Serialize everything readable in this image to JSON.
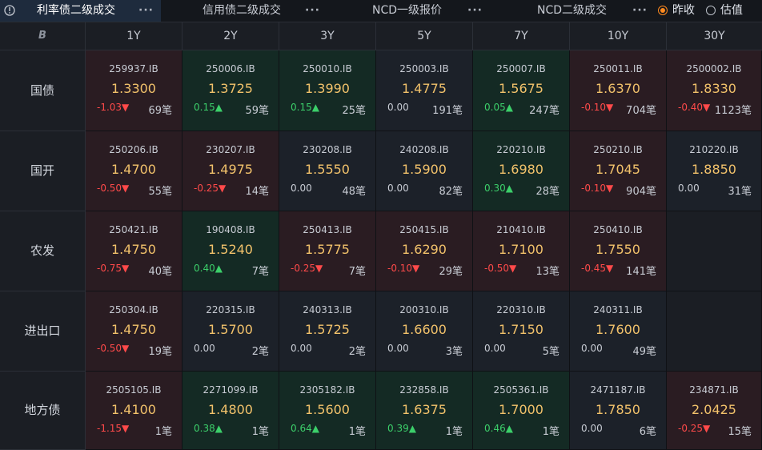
{
  "tabs": [
    {
      "label": "利率债二级成交",
      "active": true
    },
    {
      "label": "信用债二级成交",
      "active": false
    },
    {
      "label": "NCD一级报价",
      "active": false
    },
    {
      "label": "NCD二级成交",
      "active": false
    }
  ],
  "tab_menu_glyph": "···",
  "radios": [
    {
      "label": "昨收",
      "checked": true
    },
    {
      "label": "估值",
      "checked": false
    }
  ],
  "corner_logo": "B",
  "columns": [
    "1Y",
    "2Y",
    "3Y",
    "5Y",
    "7Y",
    "10Y",
    "30Y"
  ],
  "rows": [
    {
      "label": "国债",
      "cells": [
        {
          "code": "259937.IB",
          "yield": "1.3300",
          "change": "-1.03▼",
          "dir": "down",
          "count": "69笔",
          "bg": "red"
        },
        {
          "code": "250006.IB",
          "yield": "1.3725",
          "change": "0.15▲",
          "dir": "up",
          "count": "59笔",
          "bg": "green"
        },
        {
          "code": "250010.IB",
          "yield": "1.3990",
          "change": "0.15▲",
          "dir": "up",
          "count": "25笔",
          "bg": "green"
        },
        {
          "code": "250003.IB",
          "yield": "1.4775",
          "change": "0.00",
          "dir": "flat",
          "count": "191笔",
          "bg": "neutral"
        },
        {
          "code": "250007.IB",
          "yield": "1.5675",
          "change": "0.05▲",
          "dir": "up",
          "count": "247笔",
          "bg": "green"
        },
        {
          "code": "250011.IB",
          "yield": "1.6370",
          "change": "-0.10▼",
          "dir": "down",
          "count": "704笔",
          "bg": "red"
        },
        {
          "code": "2500002.IB",
          "yield": "1.8330",
          "change": "-0.40▼",
          "dir": "down",
          "count": "1123笔",
          "bg": "red"
        }
      ]
    },
    {
      "label": "国开",
      "cells": [
        {
          "code": "250206.IB",
          "yield": "1.4700",
          "change": "-0.50▼",
          "dir": "down",
          "count": "55笔",
          "bg": "red"
        },
        {
          "code": "230207.IB",
          "yield": "1.4975",
          "change": "-0.25▼",
          "dir": "down",
          "count": "14笔",
          "bg": "red"
        },
        {
          "code": "230208.IB",
          "yield": "1.5550",
          "change": "0.00",
          "dir": "flat",
          "count": "48笔",
          "bg": "neutral"
        },
        {
          "code": "240208.IB",
          "yield": "1.5900",
          "change": "0.00",
          "dir": "flat",
          "count": "82笔",
          "bg": "neutral"
        },
        {
          "code": "220210.IB",
          "yield": "1.6980",
          "change": "0.30▲",
          "dir": "up",
          "count": "28笔",
          "bg": "green"
        },
        {
          "code": "250210.IB",
          "yield": "1.7045",
          "change": "-0.10▼",
          "dir": "down",
          "count": "904笔",
          "bg": "red"
        },
        {
          "code": "210220.IB",
          "yield": "1.8850",
          "change": "0.00",
          "dir": "flat",
          "count": "31笔",
          "bg": "neutral"
        }
      ]
    },
    {
      "label": "农发",
      "cells": [
        {
          "code": "250421.IB",
          "yield": "1.4750",
          "change": "-0.75▼",
          "dir": "down",
          "count": "40笔",
          "bg": "red"
        },
        {
          "code": "190408.IB",
          "yield": "1.5240",
          "change": "0.40▲",
          "dir": "up",
          "count": "7笔",
          "bg": "green"
        },
        {
          "code": "250413.IB",
          "yield": "1.5775",
          "change": "-0.25▼",
          "dir": "down",
          "count": "7笔",
          "bg": "red"
        },
        {
          "code": "250415.IB",
          "yield": "1.6290",
          "change": "-0.10▼",
          "dir": "down",
          "count": "29笔",
          "bg": "red"
        },
        {
          "code": "210410.IB",
          "yield": "1.7100",
          "change": "-0.50▼",
          "dir": "down",
          "count": "13笔",
          "bg": "red"
        },
        {
          "code": "250410.IB",
          "yield": "1.7550",
          "change": "-0.45▼",
          "dir": "down",
          "count": "141笔",
          "bg": "red"
        },
        null
      ]
    },
    {
      "label": "进出口",
      "cells": [
        {
          "code": "250304.IB",
          "yield": "1.4750",
          "change": "-0.50▼",
          "dir": "down",
          "count": "19笔",
          "bg": "red"
        },
        {
          "code": "220315.IB",
          "yield": "1.5700",
          "change": "0.00",
          "dir": "flat",
          "count": "2笔",
          "bg": "neutral"
        },
        {
          "code": "240313.IB",
          "yield": "1.5725",
          "change": "0.00",
          "dir": "flat",
          "count": "2笔",
          "bg": "neutral"
        },
        {
          "code": "200310.IB",
          "yield": "1.6600",
          "change": "0.00",
          "dir": "flat",
          "count": "3笔",
          "bg": "neutral"
        },
        {
          "code": "220310.IB",
          "yield": "1.7150",
          "change": "0.00",
          "dir": "flat",
          "count": "5笔",
          "bg": "neutral"
        },
        {
          "code": "240311.IB",
          "yield": "1.7600",
          "change": "0.00",
          "dir": "flat",
          "count": "49笔",
          "bg": "neutral"
        },
        null
      ]
    },
    {
      "label": "地方债",
      "cells": [
        {
          "code": "2505105.IB",
          "yield": "1.4100",
          "change": "-1.15▼",
          "dir": "down",
          "count": "1笔",
          "bg": "red"
        },
        {
          "code": "2271099.IB",
          "yield": "1.4800",
          "change": "0.38▲",
          "dir": "up",
          "count": "1笔",
          "bg": "green"
        },
        {
          "code": "2305182.IB",
          "yield": "1.5600",
          "change": "0.64▲",
          "dir": "up",
          "count": "1笔",
          "bg": "green"
        },
        {
          "code": "232858.IB",
          "yield": "1.6375",
          "change": "0.39▲",
          "dir": "up",
          "count": "1笔",
          "bg": "green"
        },
        {
          "code": "2505361.IB",
          "yield": "1.7000",
          "change": "0.46▲",
          "dir": "up",
          "count": "1笔",
          "bg": "green"
        },
        {
          "code": "2471187.IB",
          "yield": "1.7850",
          "change": "0.00",
          "dir": "flat",
          "count": "6笔",
          "bg": "neutral"
        },
        {
          "code": "234871.IB",
          "yield": "2.0425",
          "change": "-0.25▼",
          "dir": "down",
          "count": "15笔",
          "bg": "red"
        }
      ]
    }
  ]
}
